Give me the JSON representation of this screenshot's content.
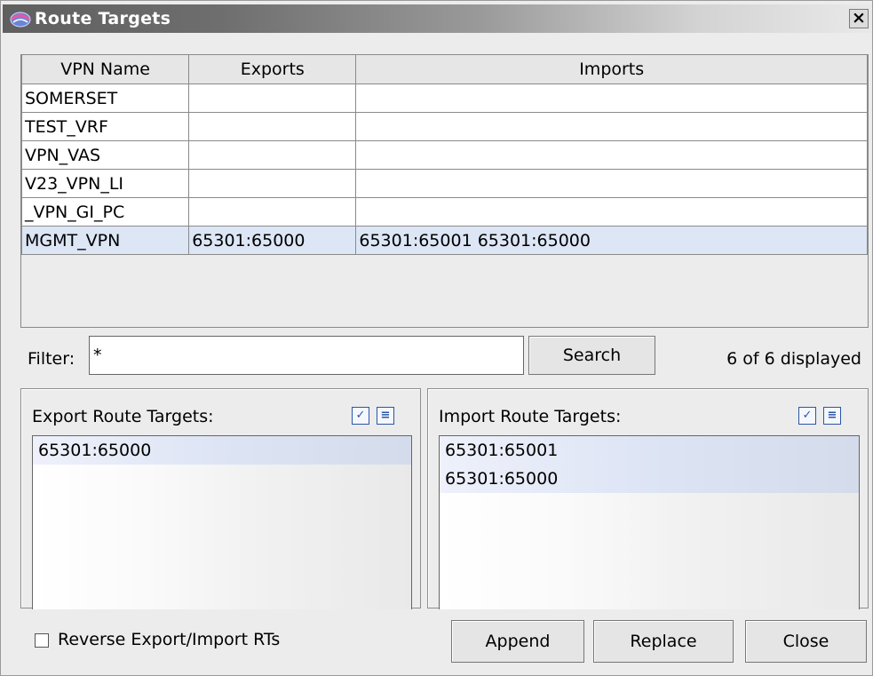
{
  "window": {
    "title": "Route Targets",
    "close_glyph": "×",
    "icon": "app-globe-icon"
  },
  "table": {
    "columns": [
      "VPN Name",
      "Exports",
      "Imports"
    ],
    "rows": [
      {
        "name": "SOMERSET",
        "exports": "",
        "imports": ""
      },
      {
        "name": "TEST_VRF",
        "exports": "",
        "imports": ""
      },
      {
        "name": "VPN_VAS",
        "exports": "",
        "imports": ""
      },
      {
        "name": "V23_VPN_LI",
        "exports": "",
        "imports": ""
      },
      {
        "name": "_VPN_GI_PC",
        "exports": "",
        "imports": ""
      },
      {
        "name": "MGMT_VPN",
        "exports": "65301:65000",
        "imports": "65301:65001 65301:65000",
        "selected": true
      }
    ]
  },
  "filter": {
    "label": "Filter:",
    "value": "*",
    "search_label": "Search",
    "count_text": "6 of 6 displayed"
  },
  "export_panel": {
    "label": "Export Route Targets:",
    "items": [
      "65301:65000"
    ],
    "icons": [
      "select-all-icon",
      "details-icon"
    ]
  },
  "import_panel": {
    "label": "Import Route Targets:",
    "items": [
      "65301:65001",
      "65301:65000"
    ],
    "icons": [
      "select-all-icon",
      "details-icon"
    ]
  },
  "bottom": {
    "reverse_label": "Reverse Export/Import RTs",
    "reverse_checked": false,
    "append_label": "Append",
    "replace_label": "Replace",
    "close_label": "Close"
  }
}
